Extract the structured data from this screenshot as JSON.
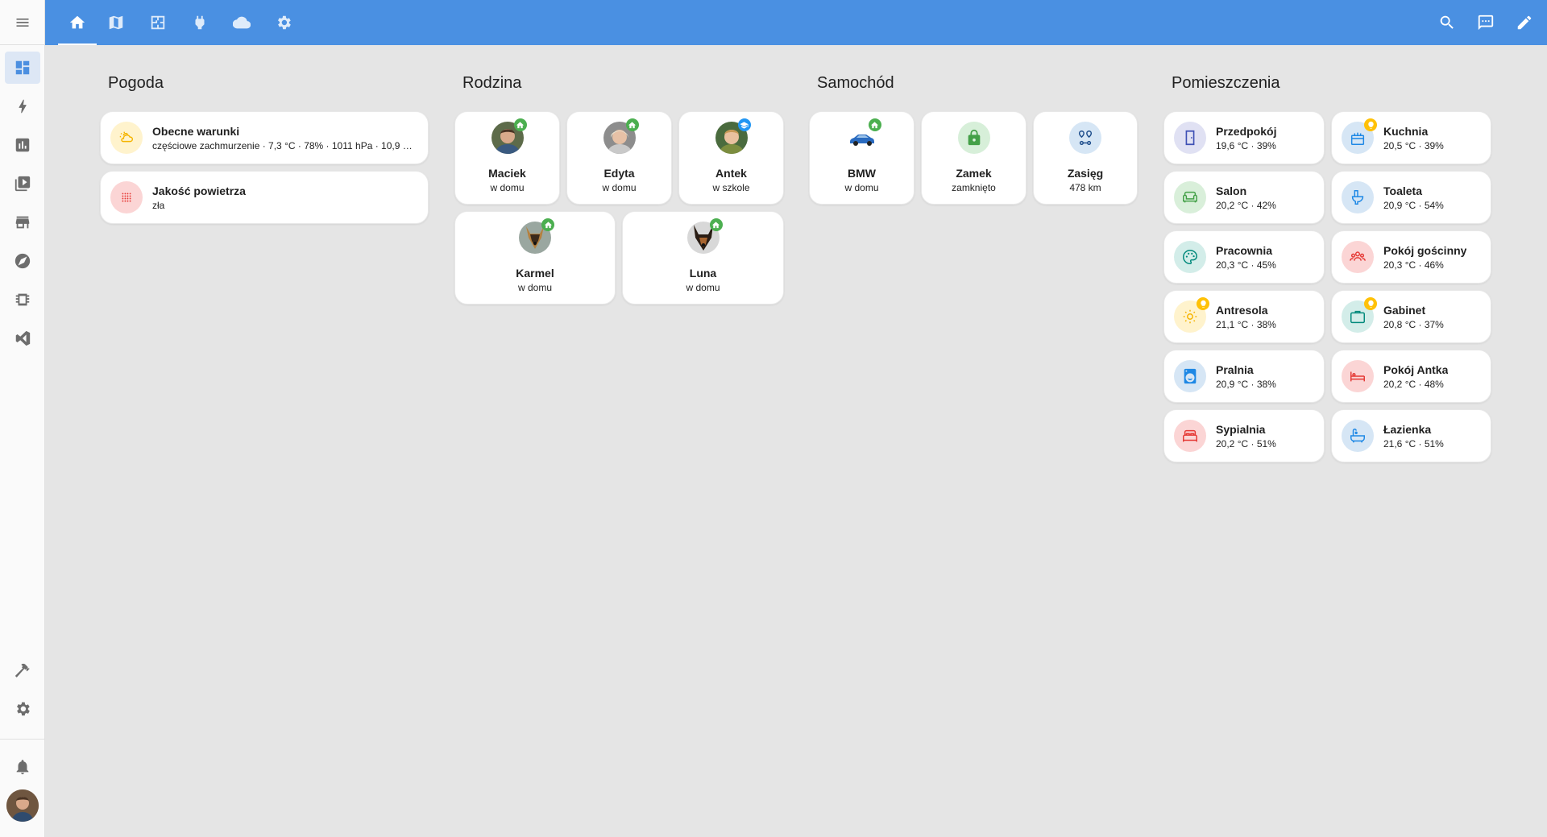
{
  "topbar": {
    "tabs": [
      "home-icon",
      "map-icon",
      "floorplan-icon",
      "plug-icon",
      "cloud-icon",
      "gear-icon"
    ],
    "actions": [
      "search-icon",
      "assist-icon",
      "edit-icon"
    ]
  },
  "sidebar": {
    "items": [
      "dashboard-icon",
      "energy-icon",
      "history-icon",
      "media-icon",
      "store-icon",
      "compass-icon",
      "chip-icon",
      "vscode-icon"
    ],
    "bottom": [
      "hammer-icon",
      "settings-icon",
      "bell-icon"
    ]
  },
  "sections": {
    "weather": "Pogoda",
    "family": "Rodzina",
    "car": "Samochód",
    "rooms": "Pomieszczenia"
  },
  "weather": [
    {
      "name": "Obecne warunki",
      "state": "częściowe zachmurzenie · 7,3 °C · 78% · 1011 hPa · 10,9 …"
    },
    {
      "name": "Jakość powietrza",
      "state": "zła"
    }
  ],
  "family": [
    {
      "name": "Maciek",
      "state": "w domu"
    },
    {
      "name": "Edyta",
      "state": "w domu"
    },
    {
      "name": "Antek",
      "state": "w szkole"
    },
    {
      "name": "Karmel",
      "state": "w domu"
    },
    {
      "name": "Luna",
      "state": "w domu"
    }
  ],
  "car": [
    {
      "name": "BMW",
      "state": "w domu"
    },
    {
      "name": "Zamek",
      "state": "zamknięto"
    },
    {
      "name": "Zasięg",
      "state": "478 km"
    }
  ],
  "rooms": [
    {
      "name": "Przedpokój",
      "state": "19,6 °C · 39%"
    },
    {
      "name": "Kuchnia",
      "state": "20,5 °C · 39%"
    },
    {
      "name": "Salon",
      "state": "20,2 °C · 42%"
    },
    {
      "name": "Toaleta",
      "state": "20,9 °C · 54%"
    },
    {
      "name": "Pracownia",
      "state": "20,3 °C · 45%"
    },
    {
      "name": "Pokój gościnny",
      "state": "20,3 °C · 46%"
    },
    {
      "name": "Antresola",
      "state": "21,1 °C · 38%"
    },
    {
      "name": "Gabinet",
      "state": "20,8 °C · 37%"
    },
    {
      "name": "Pralnia",
      "state": "20,9 °C · 38%"
    },
    {
      "name": "Pokój Antka",
      "state": "20,2 °C · 48%"
    },
    {
      "name": "Sypialnia",
      "state": "20,2 °C · 51%"
    },
    {
      "name": "Łazienka",
      "state": "21,6 °C · 51%"
    }
  ]
}
